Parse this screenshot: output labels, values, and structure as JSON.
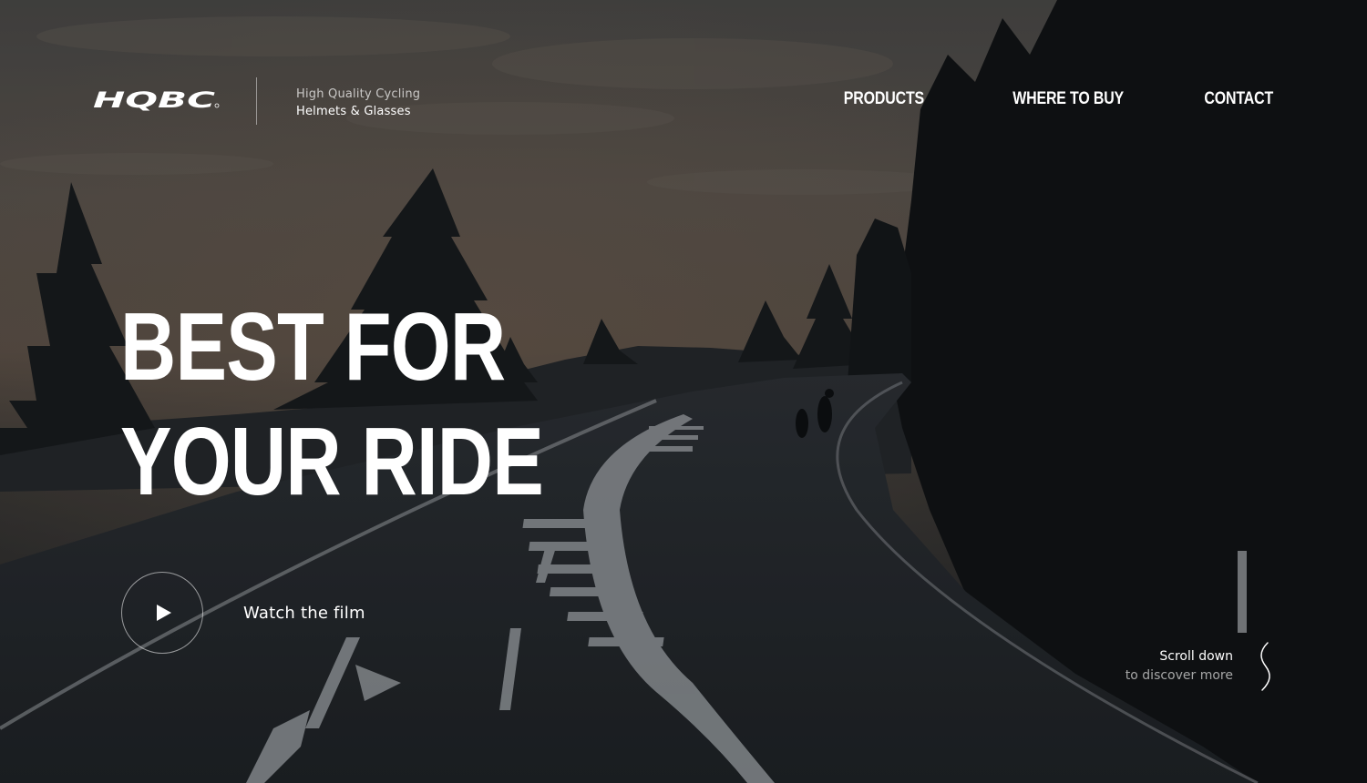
{
  "brand": {
    "logo_text": "HQBC",
    "tagline_line1": "High Quality Cycling",
    "tagline_line2": "Helmets & Glasses"
  },
  "nav": {
    "items": [
      {
        "label": "PRODUCTS"
      },
      {
        "label": "WHERE TO BUY"
      },
      {
        "label": "CONTACT"
      }
    ]
  },
  "hero": {
    "title_line1": "BEST FOR",
    "title_line2": "YOUR RIDE",
    "watch_label": "Watch the film"
  },
  "scroll": {
    "line1": "Scroll down",
    "line2": "to discover more"
  },
  "colors": {
    "text": "#ffffff",
    "sky_top": "#4d4a48",
    "sky_mid": "#5e544d",
    "road": "#23262b",
    "forest": "#101214"
  },
  "icons": {
    "play": "play-icon",
    "scroll": "scroll-squiggle-icon"
  }
}
